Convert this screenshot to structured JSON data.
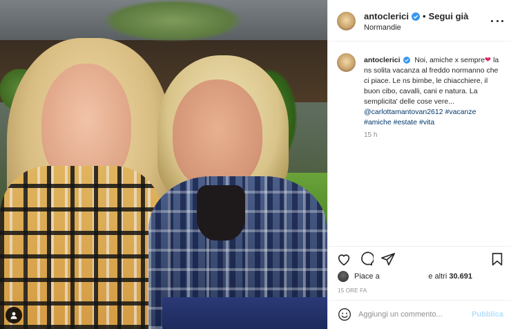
{
  "post": {
    "image_alt_icon": "user-tag-icon"
  },
  "header": {
    "username": "antoclerici",
    "separator": "•",
    "follow_label": "Segui già",
    "location": "Normandie",
    "more_icon": "more-horizontal-icon"
  },
  "caption": {
    "username": "antoclerici",
    "line1": "Noi, amiche x sempre",
    "heart": "❤",
    "body": "la ns solita vacanza al freddo normanno che ci piace. Le ns bimbe, le chiacchiere, il buon cibo, cavalli, cani e natura. La semplicita' delle cose vere...",
    "mention": "@carlottamantovan2612",
    "hashtags": [
      "#vacanze",
      "#amiche",
      "#estate",
      "#vita"
    ],
    "time": "15 h"
  },
  "actions": {
    "like_icon": "heart-icon",
    "comment_icon": "comment-icon",
    "share_icon": "share-icon",
    "save_icon": "bookmark-icon"
  },
  "likes": {
    "prefix": "Piace a",
    "suffix": "e altri",
    "count": "30.691"
  },
  "posted_ago": "15 ORE FA",
  "comment": {
    "placeholder": "Aggiungi un commento...",
    "publish_label": "Pubblica",
    "emoji_icon": "emoji-icon"
  },
  "colors": {
    "text": "#262626",
    "muted": "#8e8e8e",
    "link": "#00376b",
    "verified": "#3897f0",
    "publish_disabled": "#b2dffc",
    "heart": "#e0245e"
  }
}
